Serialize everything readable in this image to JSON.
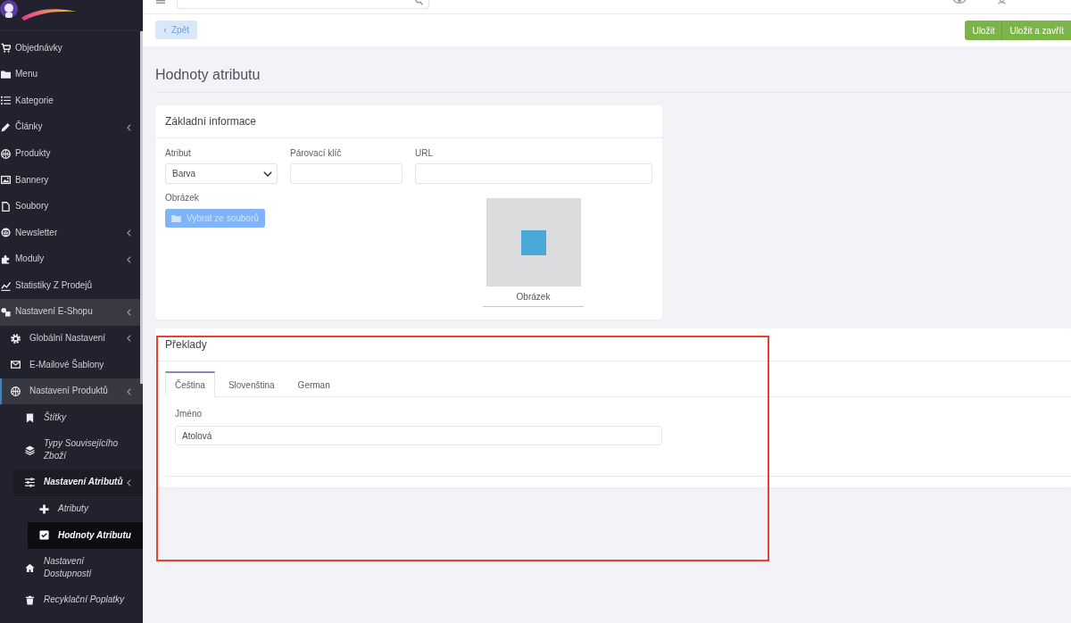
{
  "sidebar": {
    "items": [
      {
        "label": "Objednávky",
        "has_submenu": false,
        "expanded": false,
        "selected": false
      },
      {
        "label": "Menu",
        "has_submenu": false,
        "expanded": false,
        "selected": false
      },
      {
        "label": "Kategorie",
        "has_submenu": false,
        "expanded": false,
        "selected": false
      },
      {
        "label": "Články",
        "has_submenu": true,
        "expanded": false,
        "selected": false
      },
      {
        "label": "Produkty",
        "has_submenu": false,
        "expanded": false,
        "selected": false
      },
      {
        "label": "Bannery",
        "has_submenu": false,
        "expanded": false,
        "selected": false
      },
      {
        "label": "Soubory",
        "has_submenu": false,
        "expanded": false,
        "selected": false
      },
      {
        "label": "Newsletter",
        "has_submenu": true,
        "expanded": false,
        "selected": false
      },
      {
        "label": "Moduly",
        "has_submenu": true,
        "expanded": false,
        "selected": false
      },
      {
        "label": "Statistiky Z Prodejů",
        "has_submenu": false,
        "expanded": false,
        "selected": false
      },
      {
        "label": "Nastavení E-Shopu",
        "has_submenu": true,
        "expanded": true,
        "selected": false,
        "children": [
          {
            "label": "Globální Nastavení",
            "has_submenu": true,
            "expanded": false,
            "selected": false
          },
          {
            "label": "E-Mailové Šablony",
            "has_submenu": false,
            "expanded": false,
            "selected": false
          },
          {
            "label": "Nastavení Produktů",
            "has_submenu": true,
            "expanded": true,
            "selected": false,
            "children": [
              {
                "label": "Štítky",
                "has_submenu": false,
                "expanded": false,
                "selected": false
              },
              {
                "label": "Typy Souvisejícího Zboží",
                "has_submenu": false,
                "expanded": false,
                "selected": false
              },
              {
                "label": "Nastavení Atributů",
                "has_submenu": true,
                "expanded": true,
                "selected": false,
                "children": [
                  {
                    "label": "Atributy",
                    "has_submenu": false,
                    "expanded": false,
                    "selected": false
                  },
                  {
                    "label": "Hodnoty Atributu",
                    "has_submenu": false,
                    "expanded": false,
                    "selected": true
                  }
                ]
              },
              {
                "label": "Nastavení Dostupností",
                "has_submenu": false,
                "expanded": false,
                "selected": false
              },
              {
                "label": "Recyklační Poplatky",
                "has_submenu": false,
                "expanded": false,
                "selected": false
              }
            ]
          }
        ]
      }
    ]
  },
  "actions": {
    "back": "Zpět",
    "buttons": [
      "Uložit",
      "Uložit a zavřít"
    ]
  },
  "page_title": "Hodnoty atributu",
  "basic_info": {
    "title": "Základní informace",
    "fields": [
      {
        "label": "Atribut",
        "kind": "select",
        "value": "Barva"
      },
      {
        "label": "Párovací klíč",
        "kind": "input"
      },
      {
        "label": "URL",
        "kind": "input"
      }
    ],
    "image": {
      "label": "Obrázek",
      "button": {
        "label": "Vybrat ze souborů",
        "disabled": true
      },
      "caption": "Obrázek"
    }
  },
  "translations": {
    "title": "Překlady",
    "tabs": [
      {
        "label": "Čeština",
        "selected": true
      },
      {
        "label": "Slovenština",
        "selected": false
      },
      {
        "label": "German",
        "selected": false
      }
    ],
    "fields": [
      {
        "label": "Jméno",
        "value": "Atolová"
      }
    ]
  },
  "annotation": {
    "kind": "frame"
  }
}
